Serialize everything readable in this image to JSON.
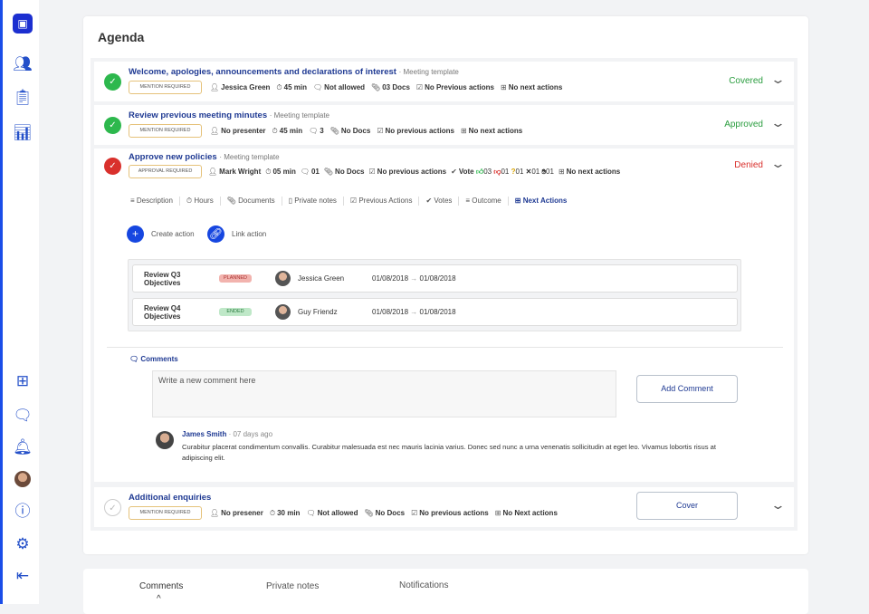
{
  "sidebar": {
    "icons": [
      "logo-icon",
      "users-icon",
      "clipboard-icon",
      "chart-icon",
      "grid-icon",
      "chat-icon",
      "bell-icon",
      "avatar",
      "help-icon",
      "gear-icon",
      "logout-icon"
    ]
  },
  "agenda": {
    "title": "Agenda",
    "items": [
      {
        "title": "Welcome, apologies, announcements and declarations of interest",
        "template": "· Meeting template",
        "badge": "MENTION REQUIRED",
        "presenter": "Jessica Green",
        "duration": "45 min",
        "comments": "Not allowed",
        "docs": "03 Docs",
        "prev": "No Previous actions",
        "next": "No next actions",
        "status": "Covered"
      },
      {
        "title": "Review previous meeting minutes",
        "template": "· Meeting template",
        "badge": "MENTION REQUIRED",
        "presenter": "No presenter",
        "duration": "45 min",
        "comments": "3",
        "docs": "No Docs",
        "prev": "No previous actions",
        "next": "No next actions",
        "status": "Approved"
      },
      {
        "title": "Approve new policies",
        "template": "· Meeting template",
        "badge": "APPROVAL REQUIRED",
        "presenter": "Mark Wright",
        "duration": "05 min",
        "comments": "01",
        "docs": "No Docs",
        "prev": "No previous actions",
        "vote_label": "Vote",
        "votes": {
          "yes": "03",
          "no": "01",
          "unsure": "01",
          "abstain": "01",
          "other": "01"
        },
        "next": "No next actions",
        "status": "Denied",
        "tabs": [
          "Description",
          "Hours",
          "Documents",
          "Private notes",
          "Previous Actions",
          "Votes",
          "Outcome",
          "Next Actions"
        ],
        "create_action": "Create action",
        "link_action": "Link action",
        "actions": [
          {
            "name": "Review Q3 Objectives",
            "status": "PLANNED",
            "person": "Jessica Green",
            "start": "01/08/2018",
            "end": "01/08/2018"
          },
          {
            "name": "Review Q4 Objectives",
            "status": "ENDED",
            "person": "Guy Friendz",
            "start": "01/08/2018",
            "end": "01/08/2018"
          }
        ],
        "comments_label": "Comments",
        "comment_placeholder": "Write a new comment here",
        "add_comment": "Add Comment",
        "comment": {
          "author": "James Smith",
          "time": "· 07 days ago",
          "text": "Curabitur placerat condimentum convallis. Curabitur malesuada est nec mauris lacinia varius. Donec sed nunc a urna venenatis sollicitudin at eget leo. Vivamus lobortis risus at adipiscing elit."
        }
      },
      {
        "title": "Additional enquiries",
        "badge": "MENTION REQUIRED",
        "presenter": "No presener",
        "duration": "30 min",
        "comments": "Not allowed",
        "docs": "No Docs",
        "prev": "No previous actions",
        "next": "No Next actions",
        "button": "Cover"
      }
    ]
  },
  "bottom_tabs": [
    "Comments",
    "Private notes",
    "Notifications"
  ],
  "colors": {
    "accent": "#1646e0",
    "green": "#2db84d",
    "red": "#d9302c"
  }
}
